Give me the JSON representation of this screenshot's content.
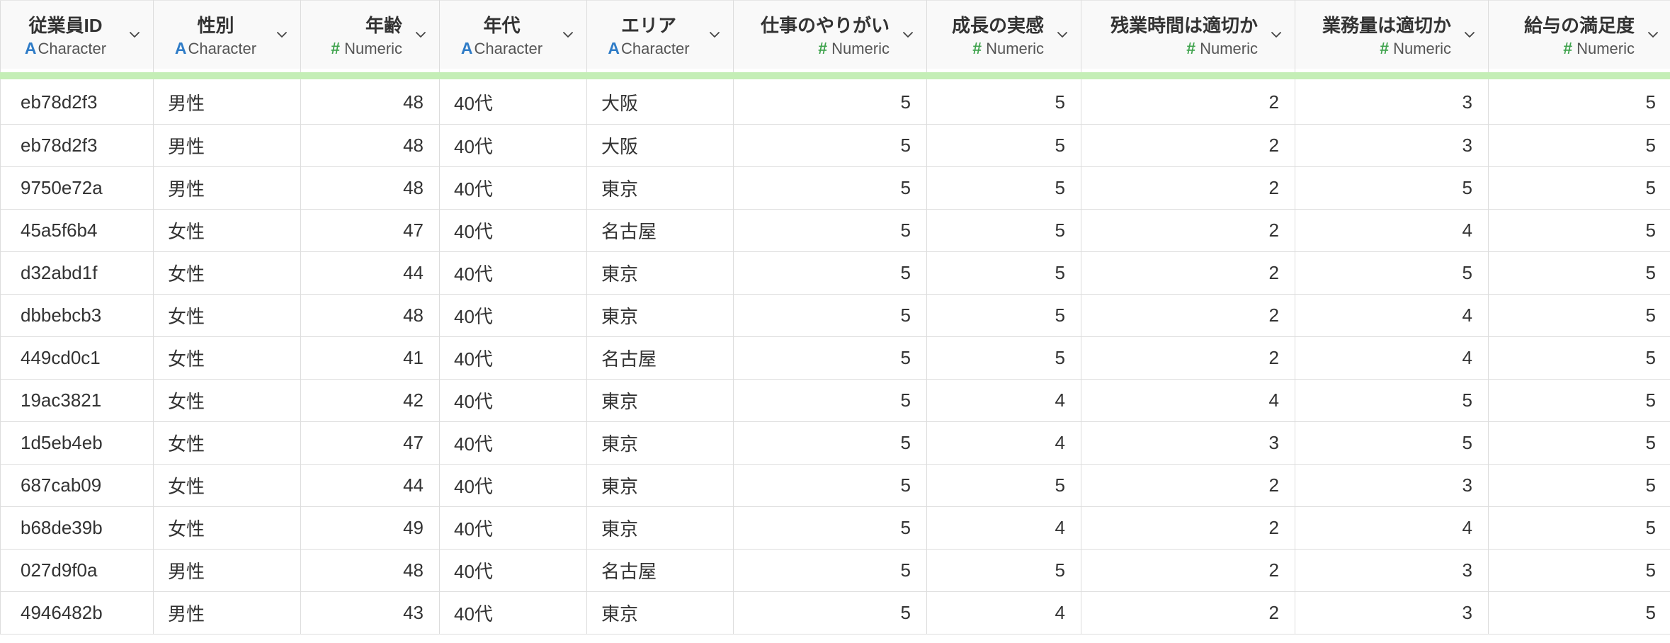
{
  "columns": [
    {
      "name": "従業員ID",
      "type": "Character",
      "kind": "char"
    },
    {
      "name": "性別",
      "type": "Character",
      "kind": "char"
    },
    {
      "name": "年齢",
      "type": "Numeric",
      "kind": "num"
    },
    {
      "name": "年代",
      "type": "Character",
      "kind": "char"
    },
    {
      "name": "エリア",
      "type": "Character",
      "kind": "char"
    },
    {
      "name": "仕事のやりがい",
      "type": "Numeric",
      "kind": "num"
    },
    {
      "name": "成長の実感",
      "type": "Numeric",
      "kind": "num"
    },
    {
      "name": "残業時間は適切か",
      "type": "Numeric",
      "kind": "num"
    },
    {
      "name": "業務量は適切か",
      "type": "Numeric",
      "kind": "num"
    },
    {
      "name": "給与の満足度",
      "type": "Numeric",
      "kind": "num"
    }
  ],
  "icons": {
    "character": "A",
    "numeric": "#"
  },
  "colors": {
    "character_icon": "#2f7cc7",
    "numeric_icon": "#3fa34d",
    "header_bar": "#c4eeb6"
  },
  "rows": [
    [
      "eb78d2f3",
      "男性",
      "48",
      "40代",
      "大阪",
      "5",
      "5",
      "2",
      "3",
      "5"
    ],
    [
      "eb78d2f3",
      "男性",
      "48",
      "40代",
      "大阪",
      "5",
      "5",
      "2",
      "3",
      "5"
    ],
    [
      "9750e72a",
      "男性",
      "48",
      "40代",
      "東京",
      "5",
      "5",
      "2",
      "5",
      "5"
    ],
    [
      "45a5f6b4",
      "女性",
      "47",
      "40代",
      "名古屋",
      "5",
      "5",
      "2",
      "4",
      "5"
    ],
    [
      "d32abd1f",
      "女性",
      "44",
      "40代",
      "東京",
      "5",
      "5",
      "2",
      "5",
      "5"
    ],
    [
      "dbbebcb3",
      "女性",
      "48",
      "40代",
      "東京",
      "5",
      "5",
      "2",
      "4",
      "5"
    ],
    [
      "449cd0c1",
      "女性",
      "41",
      "40代",
      "名古屋",
      "5",
      "5",
      "2",
      "4",
      "5"
    ],
    [
      "19ac3821",
      "女性",
      "42",
      "40代",
      "東京",
      "5",
      "4",
      "4",
      "5",
      "5"
    ],
    [
      "1d5eb4eb",
      "女性",
      "47",
      "40代",
      "東京",
      "5",
      "4",
      "3",
      "5",
      "5"
    ],
    [
      "687cab09",
      "女性",
      "44",
      "40代",
      "東京",
      "5",
      "5",
      "2",
      "3",
      "5"
    ],
    [
      "b68de39b",
      "女性",
      "49",
      "40代",
      "東京",
      "5",
      "4",
      "2",
      "4",
      "5"
    ],
    [
      "027d9f0a",
      "男性",
      "48",
      "40代",
      "名古屋",
      "5",
      "5",
      "2",
      "3",
      "5"
    ],
    [
      "4946482b",
      "男性",
      "43",
      "40代",
      "東京",
      "5",
      "4",
      "2",
      "3",
      "5"
    ]
  ]
}
